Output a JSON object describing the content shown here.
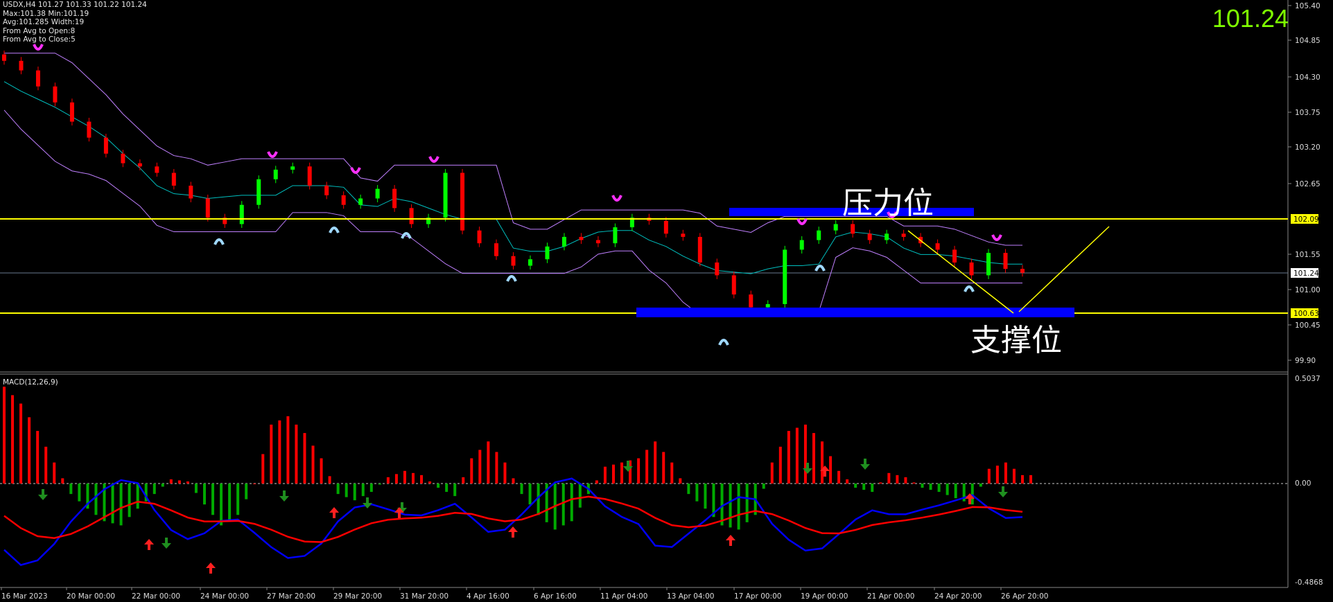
{
  "header": {
    "symbol_line": "USDX,H4  101.27 101.33 101.22 101.24",
    "max_min": "Max:101.38 Min:101.19",
    "avg_width": "Avg:101.285 Width:19",
    "from_open": "From Avg to Open:8",
    "from_close": "From Avg to Close:5"
  },
  "current_price": "101.24",
  "annotations": {
    "resistance": "压力位",
    "support": "支撑位"
  },
  "macd_label": "MACD(12,26,9)",
  "price_axis": {
    "ticks": [
      "105.40",
      "104.85",
      "104.30",
      "103.75",
      "103.20",
      "102.65",
      "102.09",
      "101.55",
      "101.24",
      "101.00",
      "100.63",
      "100.45",
      "99.90"
    ],
    "min": 99.7,
    "max": 105.5
  },
  "macd_axis": {
    "ticks": [
      "0.5037",
      "0.00",
      "-0.4868"
    ]
  },
  "time_axis": {
    "labels": [
      "16 Mar 2023",
      "20 Mar 00:00",
      "22 Mar 00:00",
      "24 Mar 00:00",
      "27 Mar 20:00",
      "29 Mar 20:00",
      "31 Mar 20:00",
      "4 Apr 16:00",
      "6 Apr 16:00",
      "11 Apr 04:00",
      "13 Apr 04:00",
      "17 Apr 00:00",
      "19 Apr 00:00",
      "21 Apr 00:00",
      "24 Apr 20:00",
      "26 Apr 20:00"
    ]
  },
  "levels": {
    "resistance_value": 102.09,
    "support_value": 100.63,
    "current_value": 101.24
  },
  "colors": {
    "up_candle": "#00ff00",
    "down_candle": "#ff0000",
    "level_line": "#ffff00",
    "zone": "#0000ff",
    "macd_pos": "#ff0000",
    "macd_neg": "#00aa00",
    "macd_line": "#0000ff",
    "signal_line": "#ff0000",
    "channel": "#c080ff",
    "mid": "#00c0c0",
    "accent_price": "#7fff00"
  },
  "chart_data": {
    "type": "line",
    "close_path": [
      104.55,
      104.4,
      104.15,
      103.9,
      103.6,
      103.35,
      103.1,
      102.95,
      102.9,
      102.8,
      102.6,
      102.4,
      102.1,
      102.0,
      102.3,
      102.7,
      102.85,
      102.9,
      102.6,
      102.45,
      102.3,
      102.4,
      102.55,
      102.25,
      102.0,
      102.1,
      102.8,
      101.9,
      101.7,
      101.5,
      101.35,
      101.45,
      101.65,
      101.8,
      101.75,
      101.7,
      101.95,
      102.1,
      102.05,
      101.85,
      101.8,
      101.4,
      101.2,
      100.9,
      100.7,
      100.75,
      101.6,
      101.75,
      101.9,
      102.0,
      101.85,
      101.75,
      101.85,
      101.8,
      101.7,
      101.6,
      101.4,
      101.2,
      101.55,
      101.3,
      101.24
    ],
    "macd_hist": [
      0.46,
      0.38,
      0.25,
      0.1,
      -0.05,
      -0.12,
      -0.18,
      -0.2,
      -0.12,
      -0.05,
      0.02,
      0.01,
      -0.1,
      -0.2,
      -0.15,
      0.0,
      0.28,
      0.32,
      0.24,
      0.12,
      -0.05,
      -0.08,
      -0.04,
      0.03,
      0.06,
      0.04,
      -0.02,
      -0.06,
      0.12,
      0.2,
      0.1,
      -0.05,
      -0.15,
      -0.22,
      -0.18,
      -0.05,
      0.08,
      0.1,
      0.12,
      0.2,
      0.1,
      -0.05,
      -0.12,
      -0.2,
      -0.22,
      -0.15,
      0.1,
      0.25,
      0.28,
      0.2,
      0.06,
      -0.02,
      -0.04,
      0.05,
      0.03,
      -0.02,
      -0.04,
      -0.07,
      -0.1,
      0.07,
      0.1,
      0.04
    ],
    "ylim": [
      -0.4868,
      0.5037
    ]
  }
}
